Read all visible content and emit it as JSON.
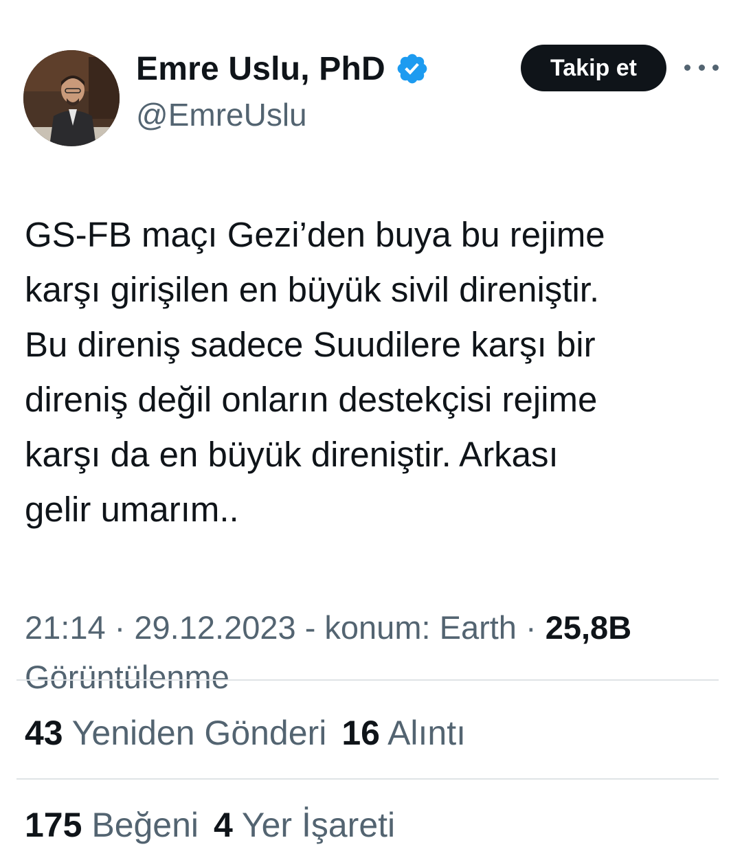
{
  "author": {
    "display_name": "Emre Uslu, PhD",
    "handle": "@EmreUslu",
    "verified": true,
    "verified_color": "#1d9bf0"
  },
  "follow_button": {
    "label": "Takip et"
  },
  "tweet": {
    "text_lines": [
      "GS-FB maçı Gezi’den buya bu rejime",
      "karşı girişilen en büyük sivil direniştir.",
      "Bu direniş sadece Suudilere karşı bir",
      "direniş değil onların destekçisi rejime",
      "karşı da en büyük direniştir. Arkası",
      "gelir umarım.."
    ]
  },
  "meta": {
    "time": "21:14",
    "separator": " · ",
    "date": "29.12.2023",
    "location_text": " - konum: Earth",
    "views_count": "25,8B",
    "views_label": "Görüntülenme"
  },
  "stats": {
    "reposts": {
      "count": "43",
      "label": "Yeniden Gönderi"
    },
    "quotes": {
      "count": "16",
      "label": "Alıntı"
    },
    "likes": {
      "count": "175",
      "label": "Beğeni"
    },
    "bookmarks": {
      "count": "4",
      "label": "Yer İşareti"
    }
  },
  "icons": {
    "verified": "verified-badge-icon",
    "more": "more-options-icon"
  }
}
